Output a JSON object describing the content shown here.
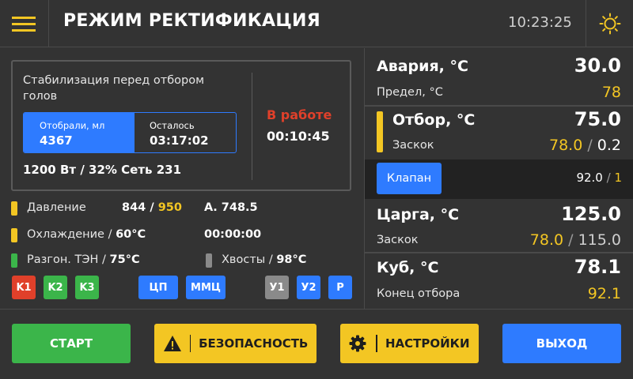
{
  "header": {
    "title": "РЕЖИМ РЕКТИФИКАЦИЯ",
    "clock": "10:23:25",
    "menu_icon": "hamburger-menu-icon",
    "theme_icon": "sun-icon"
  },
  "stage": {
    "description": "Стабилизация перед отбором голов",
    "collected_label": "Отобрали, мл",
    "collected_value": "4367",
    "remaining_label": "Осталось",
    "remaining_value": "03:17:02",
    "power_line": "1200 Вт / 32% Сеть 231",
    "status": "В работе",
    "status_time": "00:10:45"
  },
  "sensors": {
    "pressure_label": "Давление",
    "pressure_value": "844",
    "pressure_sep": " / ",
    "pressure_limit": "950",
    "atm_label": "А. 748.5",
    "cooling_label": "Охлаждение / ",
    "cooling_value": "60°C",
    "cooling_time": "00:00:00",
    "heater_label": "Разгон. ТЭН  / ",
    "heater_value": "75°C",
    "tails_label": "Хвосты / ",
    "tails_value": "98°C"
  },
  "tags": [
    {
      "label": "K1",
      "color": "#e0402a"
    },
    {
      "label": "K2",
      "color": "#3bb54a"
    },
    {
      "label": "K3",
      "color": "#3bb54a"
    },
    {
      "label": "ЦП",
      "color": "#2e7bff"
    },
    {
      "label": "ММЦ",
      "color": "#2e7bff"
    },
    {
      "label": "У1",
      "color": "#8a8a8a"
    },
    {
      "label": "У2",
      "color": "#2e7bff"
    },
    {
      "label": "Р",
      "color": "#2e7bff"
    }
  ],
  "right": {
    "alarm_label": "Авария, °C",
    "alarm_value": "30.0",
    "limit_label": "Предел, °C",
    "limit_value": "78",
    "draw_label": "Отбор, °C",
    "draw_value": "75.0",
    "draw_jump_label": "Заскок",
    "draw_jump_value": "78.0",
    "draw_jump_sep": " / ",
    "draw_jump_delta": "0.2",
    "valve_label": "Клапан",
    "valve_value": "92.0",
    "valve_sep": " / ",
    "valve_count": "1",
    "column_label": "Царга, °C",
    "column_value": "125.0",
    "column_jump_label": "Заскок",
    "column_jump_value": "78.0",
    "column_jump_sep": " / ",
    "column_jump_max": "115.0",
    "cube_label": "Куб, °C",
    "cube_value": "78.1",
    "cube_end_label": "Конец отбора",
    "cube_end_value": "92.1"
  },
  "buttons": {
    "start": "СТАРТ",
    "safety": "БЕЗОПАСНОСТЬ",
    "settings": "НАСТРОЙКИ",
    "exit": "ВЫХОД"
  },
  "colors": {
    "accent_yellow": "#f3c623",
    "accent_blue": "#2e7bff",
    "accent_green": "#3bb54a",
    "alert_red": "#e0402a",
    "background": "#333333"
  }
}
